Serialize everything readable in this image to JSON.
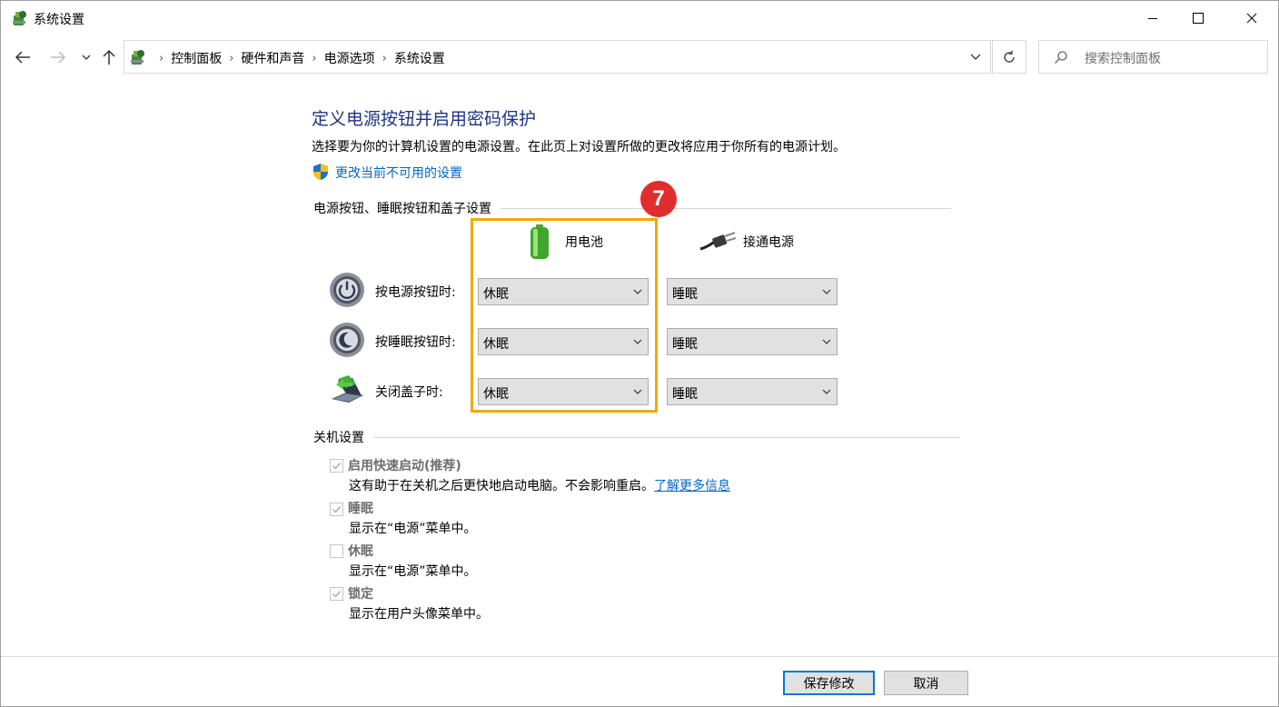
{
  "window": {
    "title": "系统设置"
  },
  "address": {
    "crumbs": [
      "控制面板",
      "硬件和声音",
      "电源选项",
      "系统设置"
    ]
  },
  "search": {
    "placeholder": "搜索控制面板"
  },
  "page": {
    "title": "定义电源按钮并启用密码保护",
    "description": "选择要为你的计算机设置的电源设置。在此页上对设置所做的更改将应用于你所有的电源计划。",
    "change_link": "更改当前不可用的设置"
  },
  "buttons_section": {
    "heading": "电源按钮、睡眠按钮和盖子设置",
    "col_battery": "用电池",
    "col_plugged": "接通电源",
    "rows": [
      {
        "label": "按电源按钮时:",
        "battery": "休眠",
        "plugged": "睡眠"
      },
      {
        "label": "按睡眠按钮时:",
        "battery": "休眠",
        "plugged": "睡眠"
      },
      {
        "label": "关闭盖子时:",
        "battery": "休眠",
        "plugged": "睡眠"
      }
    ]
  },
  "annotation": {
    "step": "7",
    "highlight_color": "#f2a900",
    "badge_color": "#e02d2d"
  },
  "shutdown_section": {
    "heading": "关机设置",
    "items": [
      {
        "label": "启用快速启动(推荐)",
        "checked": true,
        "desc": "这有助于在关机之后更快地启动电脑。不会影响重启。",
        "link": "了解更多信息"
      },
      {
        "label": "睡眠",
        "checked": true,
        "desc": "显示在“电源”菜单中。"
      },
      {
        "label": "休眠",
        "checked": false,
        "desc": "显示在“电源”菜单中。"
      },
      {
        "label": "锁定",
        "checked": true,
        "desc": "显示在用户头像菜单中。"
      }
    ]
  },
  "footer": {
    "save": "保存修改",
    "cancel": "取消"
  },
  "colors": {
    "title_blue": "#1e3287",
    "link_blue": "#0066cc",
    "primary_border": "#0078d7"
  }
}
